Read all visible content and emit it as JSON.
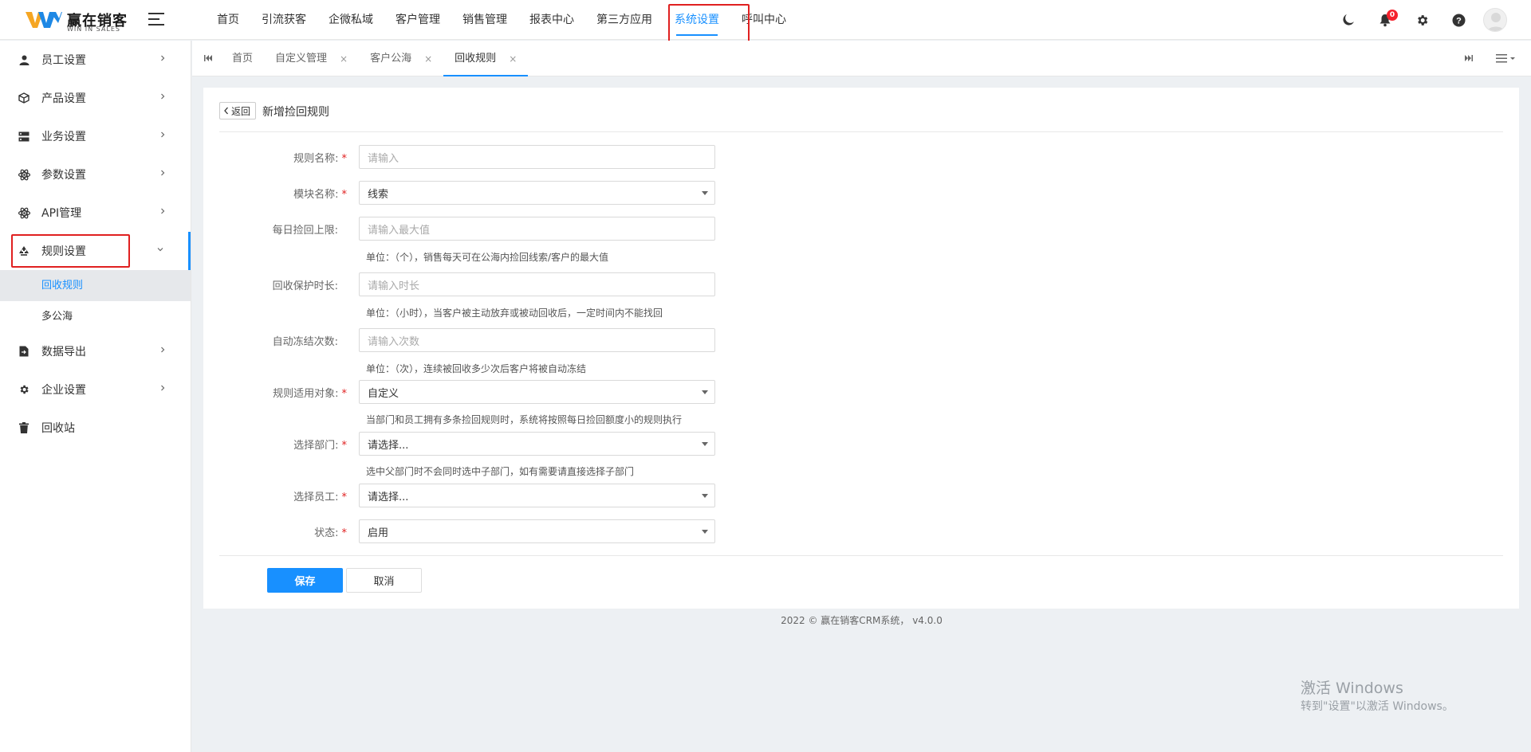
{
  "brand": {
    "name": "赢在销客",
    "sub": "WIN IN SALES"
  },
  "topnav": {
    "items": [
      "首页",
      "引流获客",
      "企微私域",
      "客户管理",
      "销售管理",
      "报表中心",
      "第三方应用",
      "系统设置",
      "呼叫中心"
    ],
    "active": "系统设置",
    "notification_count": "0"
  },
  "sidebar": {
    "items": [
      {
        "label": "员工设置",
        "icon": "user-icon"
      },
      {
        "label": "产品设置",
        "icon": "cube-icon"
      },
      {
        "label": "业务设置",
        "icon": "server-icon"
      },
      {
        "label": "参数设置",
        "icon": "atom-icon"
      },
      {
        "label": "API管理",
        "icon": "atom-icon"
      },
      {
        "label": "规则设置",
        "icon": "recycle-icon"
      },
      {
        "label": "数据导出",
        "icon": "file-export-icon"
      },
      {
        "label": "企业设置",
        "icon": "gear-icon"
      },
      {
        "label": "回收站",
        "icon": "trash-icon"
      }
    ],
    "sub_items": [
      "回收规则",
      "多公海"
    ],
    "active_sub": "回收规则"
  },
  "tabs": [
    {
      "label": "首页",
      "closable": false
    },
    {
      "label": "自定义管理",
      "closable": true
    },
    {
      "label": "客户公海",
      "closable": true
    },
    {
      "label": "回收规则",
      "closable": true,
      "active": true
    }
  ],
  "page": {
    "back_label": "返回",
    "title": "新增捡回规则",
    "fields": {
      "rule_name": {
        "label": "规则名称:",
        "placeholder": "请输入",
        "required": true
      },
      "module_name": {
        "label": "模块名称:",
        "value": "线索",
        "required": true
      },
      "daily_limit": {
        "label": "每日捡回上限:",
        "placeholder": "请输入最大值",
        "hint": "单位：（个），销售每天可在公海内捡回线索/客户的最大值"
      },
      "protect_duration": {
        "label": "回收保护时长:",
        "placeholder": "请输入时长",
        "hint": "单位：（小时），当客户被主动放弃或被动回收后，一定时间内不能找回"
      },
      "auto_freeze": {
        "label": "自动冻结次数:",
        "placeholder": "请输入次数",
        "hint": "单位：（次），连续被回收多少次后客户将被自动冻结"
      },
      "rule_target": {
        "label": "规则适用对象:",
        "value": "自定义",
        "required": true,
        "hint": "当部门和员工拥有多条捡回规则时，系统将按照每日捡回额度小的规则执行"
      },
      "department": {
        "label": "选择部门:",
        "value": "请选择...",
        "required": true,
        "hint": "选中父部门时不会同时选中子部门，如有需要请直接选择子部门"
      },
      "employee": {
        "label": "选择员工:",
        "value": "请选择...",
        "required": true
      },
      "status": {
        "label": "状态:",
        "value": "启用",
        "required": true
      }
    },
    "save_label": "保存",
    "cancel_label": "取消"
  },
  "footer": "2022 © 赢在销客CRM系统， v4.0.0",
  "watermark": {
    "line1": "激活 Windows",
    "line2": "转到\"设置\"以激活 Windows。"
  },
  "colors": {
    "accent": "#1890ff",
    "highlight": "#e02020"
  }
}
